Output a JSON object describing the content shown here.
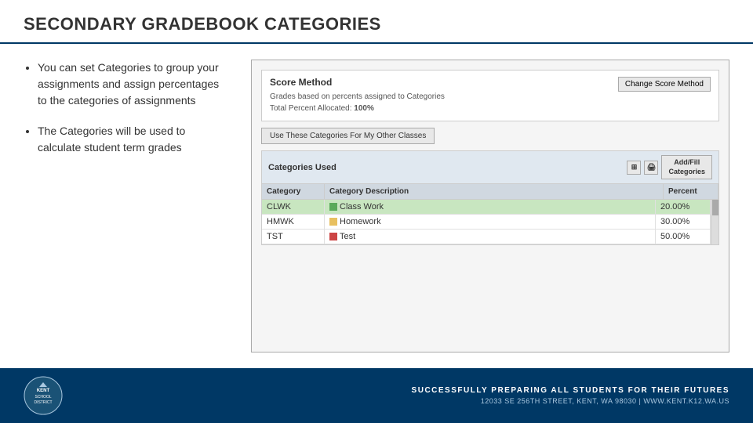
{
  "header": {
    "title": "SECONDARY GRADEBOOK CATEGORIES"
  },
  "bullets": [
    {
      "text": "You can set Categories to group your assignments and assign percentages to the categories of assignments"
    },
    {
      "text": "The Categories will be used to calculate student term grades"
    }
  ],
  "screenshot": {
    "score_method": {
      "label": "Score Method",
      "description": "Grades based on percents assigned to Categories",
      "total_percent_label": "Total Percent Allocated:",
      "total_percent_value": "100%",
      "change_btn": "Change Score Method"
    },
    "use_categories_btn": "Use These Categories For My Other Classes",
    "categories_used": {
      "header": "Categories Used",
      "add_btn_line1": "Add/Fill",
      "add_btn_line2": "Categories"
    },
    "table": {
      "columns": [
        "Category",
        "Category Description",
        "Percent"
      ],
      "rows": [
        {
          "code": "CLWK",
          "color": "#5aaa5a",
          "description": "Class Work",
          "percent": "20.00%",
          "highlight": true
        },
        {
          "code": "HMWK",
          "color": "#e8c060",
          "description": "Homework",
          "percent": "30.00%",
          "highlight": false
        },
        {
          "code": "TST",
          "color": "#cc4444",
          "description": "Test",
          "percent": "50.00%",
          "highlight": false
        }
      ]
    }
  },
  "footer": {
    "tagline": "SUCCESSFULLY PREPARING ALL STUDENTS FOR THEIR FUTURES",
    "address": "12033 SE 256TH STREET, KENT, WA 98030  |  WWW.KENT.K12.WA.US"
  }
}
